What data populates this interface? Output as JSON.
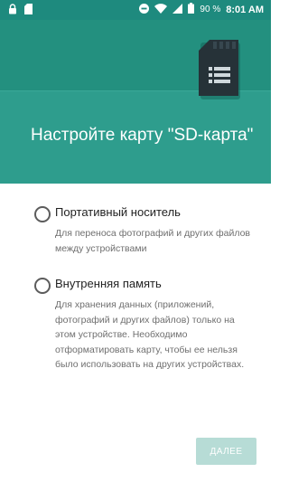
{
  "status_bar": {
    "battery_percent": "90 %",
    "time": "8:01 AM",
    "icons": [
      "lock-icon",
      "sd-card-icon",
      "do-not-disturb-icon",
      "wifi-icon",
      "cellular-signal-icon",
      "battery-icon"
    ]
  },
  "header": {
    "title": "Настройте карту \"SD-карта\"",
    "illustration": "sd-card-icon"
  },
  "options": [
    {
      "label": "Портативный носитель",
      "description": "Для переноса фотографий и других файлов между устройствами",
      "selected": false
    },
    {
      "label": "Внутренняя память",
      "description": "Для хранения данных (приложений, фотографий и других файлов) только на этом устройстве. Необходимо отформатировать карту, чтобы ее нельзя было использовать на других устройствах.",
      "selected": false
    }
  ],
  "footer": {
    "next_label": "ДАЛЕЕ",
    "next_enabled": false
  },
  "colors": {
    "status_bar": "#1e8a7e",
    "header": "#2e9d8d",
    "header_band": "#23907f",
    "button_disabled": "#b7dcd6"
  }
}
